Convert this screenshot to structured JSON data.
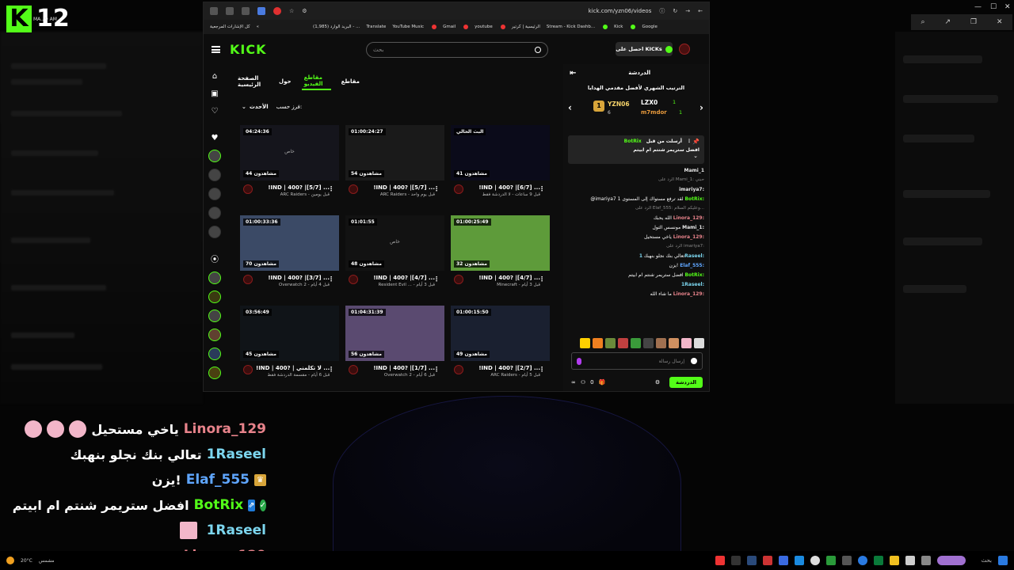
{
  "overlay": {
    "brand_number": "12",
    "brand_small": "MA.. 9 AM",
    "chat": [
      {
        "name": "Linora_129",
        "name_color": "#e8838b",
        "text": "ياخي مستحيل",
        "emotes": 3
      },
      {
        "name": "1Raseel",
        "name_color": "#7cd6ef",
        "text": "تعالي بنك نجلو بنهبك",
        "emotes": 0
      },
      {
        "name": "Elaf_555",
        "name_color": "#5fa6ff",
        "text": "يزن!",
        "emotes": 0,
        "badge": "crown"
      },
      {
        "name": "BotRix",
        "name_color": "#53fc18",
        "text": "افضل ستريمر شنتم ام ابيتم",
        "emotes": 0,
        "thumbs": 2
      },
      {
        "name": "1Raseel",
        "name_color": "#7cd6ef",
        "text": "",
        "emotes": 0,
        "pink": true
      },
      {
        "name": "Linora_129",
        "name_color": "#e8838b",
        "text": "ما شاء الله",
        "emotes": 0
      }
    ]
  },
  "browser": {
    "url": "kick.com/yzn06/videos",
    "bookmarks": [
      "كل الإشارات المرجعية",
      "البريد الوارد (1,985) - ...",
      "Translate",
      "YouTube Music",
      "Gmail",
      "youtube",
      "الرئيسية | كرتير",
      "Stream - Kick Dashb...",
      "Kick",
      "Google"
    ]
  },
  "kick": {
    "logo": "KICK",
    "search_placeholder": "بحث",
    "get_kicks": "احصل على KICKs",
    "tabs": [
      "مقاطع",
      "مقاطع الفيديو",
      "حول",
      "الصفحة الرئيسية"
    ],
    "active_tab": 1,
    "sort_label": "فرز حسب:",
    "sort_value": "الأحدث",
    "videos": [
      {
        "duration": "البث الحالي",
        "views": "41 مشاهدون",
        "title": "!IND | 400? |[6/7] ...",
        "meta": "قبل 9 ساعات - لا الدردشة فقط",
        "thumb": "#0b0b1a"
      },
      {
        "duration": "01:00:24:27",
        "views": "54 مشاهدون",
        "title": "!IND | 400? |[5/7] ...",
        "meta": "ARC Raiders - قبل يوم واحد",
        "thumb": "#1a1a1a"
      },
      {
        "duration": "04:24:36",
        "views": "44 مشاهدون",
        "title": "!IND | 400? |[5/7] ...",
        "meta": "ARC Raiders - قبل يومين",
        "thumb": "#15151c",
        "mid": "خاص"
      },
      {
        "duration": "01:00:25:49",
        "views": "32 مشاهدون",
        "title": "!IND | 400? |[4/7] ...",
        "meta": "Minecraft - قبل 3 أيام",
        "thumb": "#5e9b3a"
      },
      {
        "duration": "01:01:55",
        "views": "48 مشاهدون",
        "title": "!IND | 400? |[4/7] ...",
        "meta": "Resident Evil ... - قبل 3 أيام",
        "thumb": "#121212",
        "mid": "خاص"
      },
      {
        "duration": "01:00:33:36",
        "views": "70 مشاهدون",
        "title": "!IND | 400? |[3/7] ...",
        "meta": "Overwatch 2 - قبل 4 أيام",
        "thumb": "#3b4a66"
      },
      {
        "duration": "01:00:15:50",
        "views": "49 مشاهدون",
        "title": "!IND | 400? |[2/7] ...",
        "meta": "ARC Raiders - قبل 5 أيام",
        "thumb": "#1a2030"
      },
      {
        "duration": "01:04:31:39",
        "views": "56 مشاهدون",
        "title": "!IND | 400? |[1/7] ...",
        "meta": "Overwatch 2 - قبل 6 أيام",
        "thumb": "#5a4a70"
      },
      {
        "duration": "03:56:49",
        "views": "45 مشاهدون",
        "title": "!IND | 400? | لا تكلمني ...",
        "meta": "قبل 6 أيام - مقسمة الدردشة فقط",
        "thumb": "#101418"
      }
    ],
    "chat": {
      "title": "الدردشة",
      "leaderboard_title": "الترتيب الشهري لأفضل مقدمي الهدايا",
      "first": {
        "name": "YZN06",
        "sub": "6"
      },
      "second": {
        "name": "LZX0",
        "sub": "1"
      },
      "third": {
        "name": "m7mdor",
        "sub": "1"
      },
      "pinned_by": "أرسلت من قبل",
      "pinned_user": "BotRix",
      "pinned_text": "افضل ستريمر شنتم ام ابيتم",
      "messages": [
        {
          "user": "Mami_1",
          "color": "#e8e8e8",
          "text": "",
          "dim": false
        },
        {
          "user": "",
          "color": "#888",
          "text": "الرد على Mami_1: حبني",
          "dim": true
        },
        {
          "user": "imariya7:",
          "color": "#e8e8e8",
          "text": "",
          "dim": false
        },
        {
          "user": "BotRix:",
          "color": "#53fc18",
          "text": "@imariya7 لقد ترفع مستواك إلى المستوى 1",
          "dim": false
        },
        {
          "user": "",
          "color": "#888",
          "text": "الرد على Elaf_555: وعليكم السلام...",
          "dim": true
        },
        {
          "user": "Linora_129:",
          "color": "#e8838b",
          "text": "الله يحبك",
          "dim": false
        },
        {
          "user": "Mami_1:",
          "color": "#e8e8e8",
          "text": "مونسس التول",
          "dim": false
        },
        {
          "user": "Linora_129:",
          "color": "#e8838b",
          "text": "ياخي مستحيل",
          "dim": false
        },
        {
          "user": "",
          "color": "#888",
          "text": "الرد على imariya7:",
          "dim": true
        },
        {
          "user": "1Raseel:",
          "color": "#7cd6ef",
          "text": "تعالي بنك نجلو بنهبك",
          "dim": false
        },
        {
          "user": "Elaf_555:",
          "color": "#5fa6ff",
          "text": "يزن!",
          "dim": false
        },
        {
          "user": "BotRix:",
          "color": "#53fc18",
          "text": "افضل ستريمر شنتم ام ابيتم",
          "dim": false
        },
        {
          "user": "1Raseel:",
          "color": "#7cd6ef",
          "text": "",
          "dim": false
        },
        {
          "user": "Linora_129:",
          "color": "#e8838b",
          "text": "ما شاء الله",
          "dim": false
        }
      ],
      "input_placeholder": "إرسال رسالة",
      "counter": "0",
      "send_label": "الدردشة"
    }
  },
  "taskbar": {
    "weather": "20°C",
    "weather_desc": "مشمس",
    "search": "بحث"
  }
}
